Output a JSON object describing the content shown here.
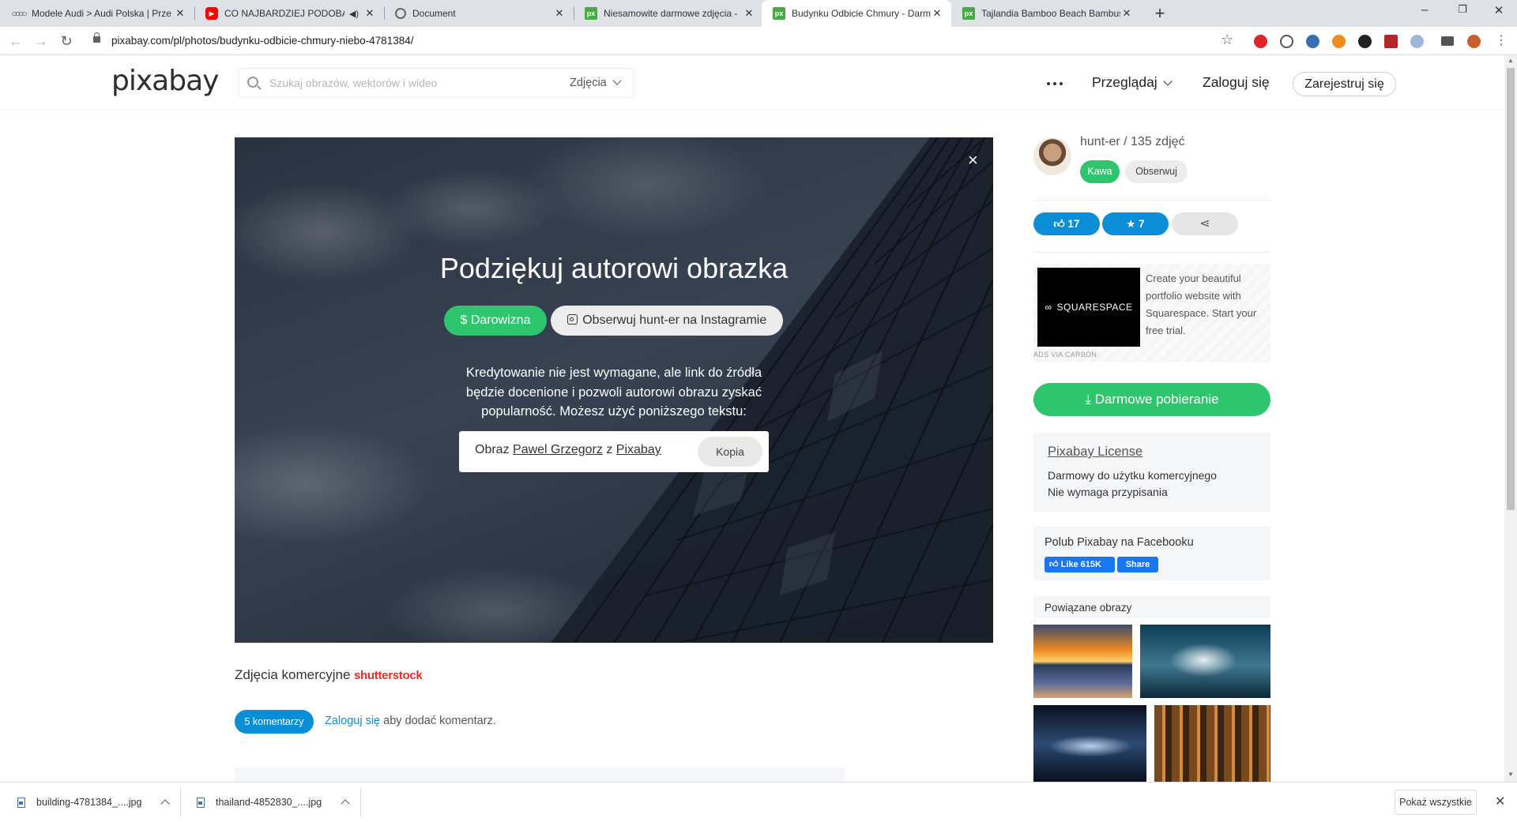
{
  "browser": {
    "tabs": [
      {
        "title": "Modele Audi > Audi Polska | Prze",
        "favicon": "audi-rings-icon"
      },
      {
        "title": "CO NAJBARDZIEJ PODOBA N",
        "favicon": "youtube-icon",
        "audio": true
      },
      {
        "title": "Document",
        "favicon": "globe-icon"
      },
      {
        "title": "Niesamowite darmowe zdjęcia -",
        "favicon": "pixabay-icon"
      },
      {
        "title": "Budynku Odbicie Chmury - Darm",
        "favicon": "pixabay-icon",
        "active": true
      },
      {
        "title": "Tajlandia Bamboo Beach Bambus",
        "favicon": "pixabay-icon"
      }
    ],
    "url": "pixabay.com/pl/photos/budynku-odbicie-chmury-niebo-4781384/",
    "window_controls": {
      "minimize": "–",
      "restore": "❐",
      "close": "✕"
    }
  },
  "header": {
    "logo": "pixabay",
    "search_placeholder": "Szukaj obrazów, wektorów i wideo",
    "search_type": "Zdjęcia",
    "browse": "Przeglądaj",
    "login": "Zaloguj się",
    "register": "Zarejestruj się"
  },
  "hero": {
    "title": "Podziękuj autorowi obrazka",
    "donate": "$ Darowizna",
    "instagram": "Obserwuj hunt-er na Instagramie",
    "credit_text": "Kredytowanie nie jest wymagane, ale link do źródła będzie docenione i pozwoli autorowi obrazu zyskać popularność. Możesz użyć poniższego tekstu:",
    "credit_prefix": "Obraz",
    "credit_author": "Pawel Grzegorz",
    "credit_mid": "z",
    "credit_site": "Pixabay",
    "copy": "Kopia",
    "close": "×"
  },
  "main": {
    "commercial_label": "Zdjęcia komercyjne",
    "shutterstock": "shutterstock",
    "comments_count": "5 komentarzy",
    "login_link": "Zaloguj się",
    "login_suffix": "aby dodać komentarz."
  },
  "sidebar": {
    "author": "hunt-er / 135 zdjęć",
    "coffee": "Kawa",
    "follow": "Obserwuj",
    "likes": "17",
    "favorites": "7",
    "ad_brand": "SQUARESPACE",
    "ad_text": "Create your beautiful portfolio website with Squarespace. Start your free trial.",
    "ad_via": "ADS VIA CARBON",
    "download": "Darmowe pobieranie",
    "license_title": "Pixabay License",
    "license_line1": "Darmowy do użytku komercyjnego",
    "license_line2": "Nie wymaga przypisania",
    "facebook_title": "Polub Pixabay na Facebooku",
    "fb_like": "Like 615K",
    "fb_share": "Share",
    "related_title": "Powiązane obrazy"
  },
  "downloads": {
    "items": [
      "building-4781384_....jpg",
      "thailand-4852830_....jpg"
    ],
    "show_all": "Pokaż wszystkie"
  },
  "colors": {
    "green": "#2ec66d",
    "blue": "#0b8ed8",
    "shutterstock_red": "#ee2b24"
  }
}
